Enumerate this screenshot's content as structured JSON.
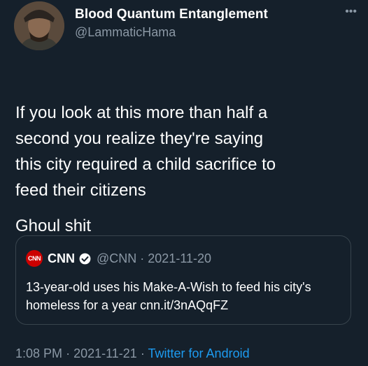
{
  "author": {
    "name": "Blood Quantum Entanglement",
    "handle": "@LammaticHama"
  },
  "more_icon": "more-horizontal-icon",
  "tweet": {
    "text": "If you look at this more than half a\nsecond you realize they're saying\nthis city required a child sacrifice to\nfeed their citizens",
    "text2": "Ghoul shit"
  },
  "quote": {
    "logo_text": "CNN",
    "name": "CNN",
    "handle": "@CNN",
    "separator": "·",
    "date": "2021-11-20",
    "text": "13-year-old uses his Make-A-Wish to feed his city's homeless for a year cnn.it/3nAQqFZ"
  },
  "meta": {
    "time": "1:08 PM",
    "separator": "·",
    "date": "2021-11-21",
    "separator2": "·",
    "source": "Twitter for Android"
  },
  "colors": {
    "background": "#15202b",
    "secondary_text": "#8b98a5",
    "link": "#1d9bf0",
    "border": "#38444d",
    "cnn_red": "#cc0000"
  }
}
